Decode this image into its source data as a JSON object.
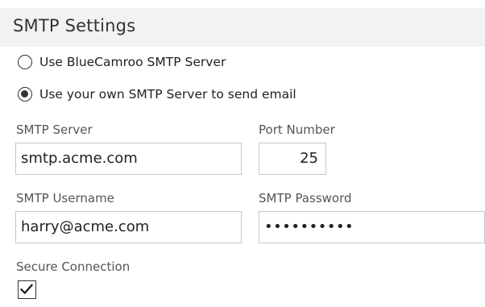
{
  "header": {
    "title": "SMTP Settings"
  },
  "server_choice": {
    "options": [
      {
        "label": "Use BlueCamroo SMTP Server",
        "selected": false
      },
      {
        "label": "Use your own SMTP Server to send email",
        "selected": true
      }
    ]
  },
  "fields": {
    "smtp_server": {
      "label": "SMTP Server",
      "value": "smtp.acme.com"
    },
    "port_number": {
      "label": "Port Number",
      "value": "25"
    },
    "smtp_username": {
      "label": "SMTP Username",
      "value": "harry@acme.com"
    },
    "smtp_password": {
      "label": "SMTP Password",
      "value": "••••••••••"
    }
  },
  "secure_connection": {
    "label": "Secure Connection",
    "checked": true
  },
  "icons": {
    "checkbox_mark": "checkmark-icon"
  }
}
